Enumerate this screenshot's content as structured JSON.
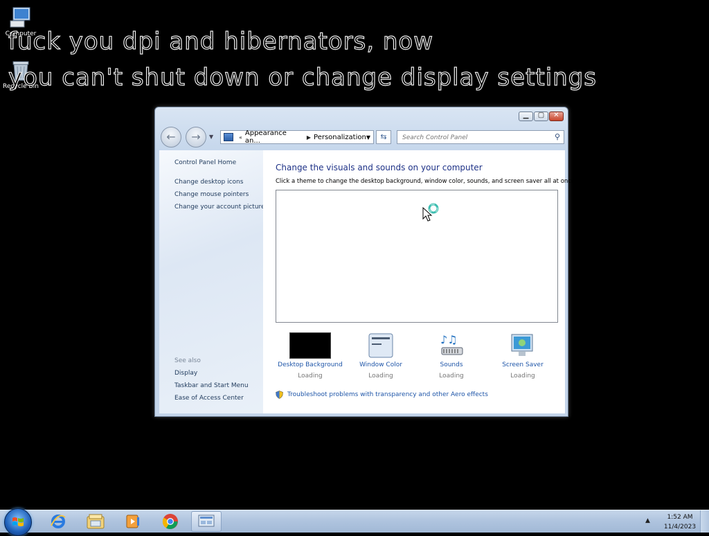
{
  "desktop": {
    "icons": [
      {
        "label": "Computer",
        "icon": "computer-icon"
      },
      {
        "label": "Recycle Bin",
        "icon": "recycle-bin-icon"
      }
    ],
    "overlay_lines": [
      "fuck you dpi and hibernators, now",
      "you can't shut down or change display settings"
    ]
  },
  "window": {
    "address": {
      "crumb_1": "Appearance an...",
      "crumb_2": "Personalization",
      "icon": "control-panel-icon"
    },
    "search": {
      "placeholder": "Search Control Panel"
    },
    "left_pane": {
      "home": "Control Panel Home",
      "links": [
        "Change desktop icons",
        "Change mouse pointers",
        "Change your account picture"
      ],
      "see_also_title": "See also",
      "see_also": [
        "Display",
        "Taskbar and Start Menu",
        "Ease of Access Center"
      ]
    },
    "content": {
      "title": "Change the visuals and sounds on your computer",
      "subtitle": "Click a theme to change the desktop background, window color, sounds, and screen saver all at once.",
      "tiles": [
        {
          "label": "Desktop Background",
          "status": "Loading",
          "icon": "desktop-background-icon"
        },
        {
          "label": "Window Color",
          "status": "Loading",
          "icon": "window-color-icon"
        },
        {
          "label": "Sounds",
          "status": "Loading",
          "icon": "sounds-icon"
        },
        {
          "label": "Screen Saver",
          "status": "Loading",
          "icon": "screen-saver-icon"
        }
      ],
      "troubleshoot": "Troubleshoot problems with transparency and other Aero effects"
    }
  },
  "taskbar": {
    "pinned": [
      "internet-explorer-icon",
      "windows-explorer-icon",
      "media-player-icon",
      "chrome-icon",
      "control-panel-icon"
    ],
    "clock": {
      "time": "1:52 AM",
      "date": "11/4/2023"
    }
  },
  "colors": {
    "link": "#1e55a8",
    "title": "#1e3287",
    "taskbar": "#aec3de"
  }
}
